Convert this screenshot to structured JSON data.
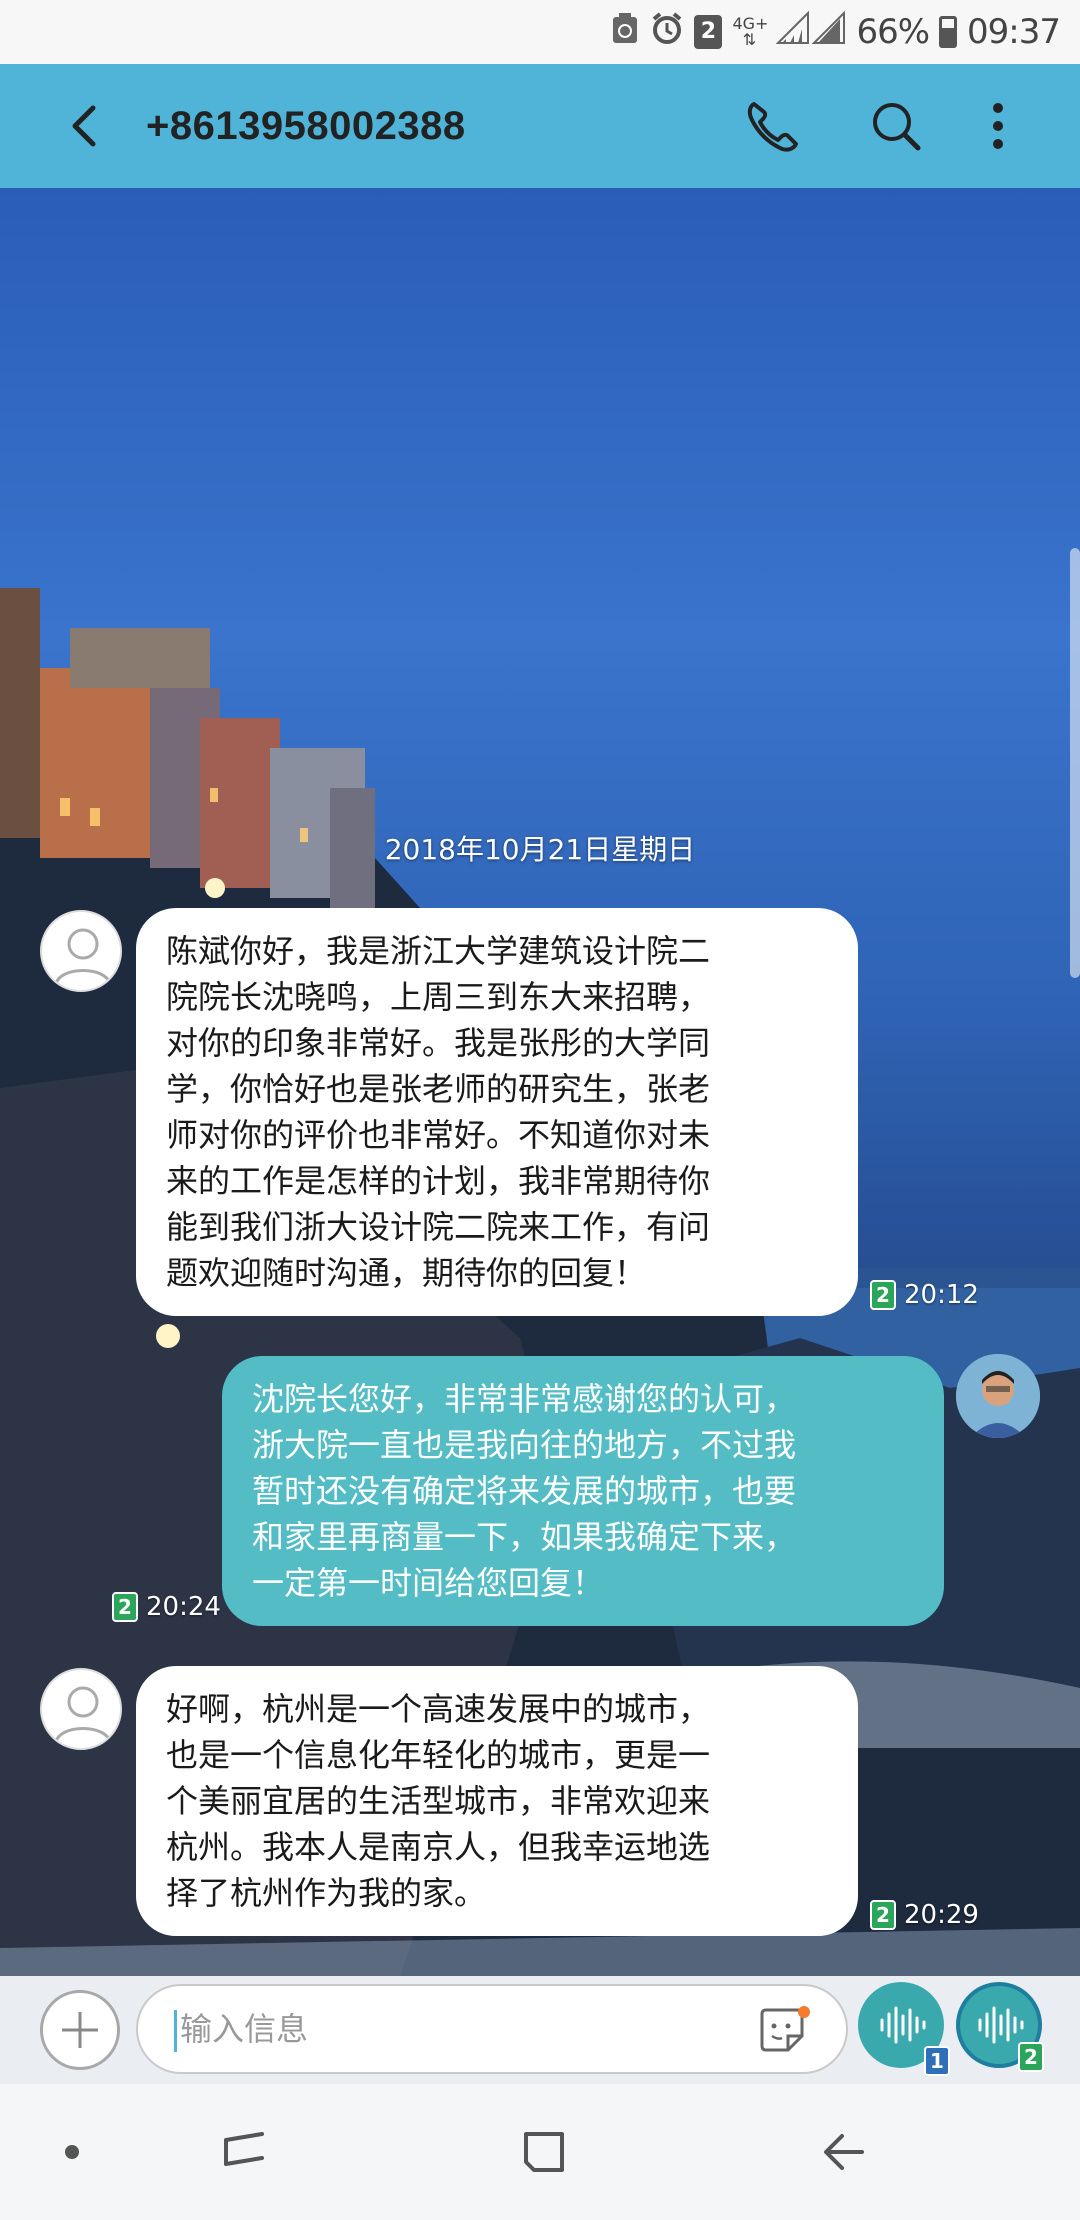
{
  "status_bar": {
    "sim_slot": "2",
    "network": "4G+",
    "battery": "66%",
    "time": "09:37"
  },
  "header": {
    "title": "+8613958002388"
  },
  "conversation": {
    "date": "2018年10月21日星期日",
    "messages": [
      {
        "direction": "incoming",
        "sim": "2",
        "time": "20:12",
        "lines": [
          "陈斌你好，我是浙江大学建筑设计院二",
          "院院长沈晓鸣，上周三到东大来招聘，",
          "对你的印象非常好。我是张彤的大学同",
          "学，你恰好也是张老师的研究生，张老",
          "师对你的评价也非常好。不知道你对未",
          "来的工作是怎样的计划，我非常期待你",
          "能到我们浙大设计院二院来工作，有问",
          "题欢迎随时沟通，期待你的回复！"
        ]
      },
      {
        "direction": "outgoing",
        "sim": "2",
        "time": "20:24",
        "lines": [
          "沈院长您好，非常非常感谢您的认可，",
          "浙大院一直也是我向往的地方，不过我",
          "暂时还没有确定将来发展的城市，也要",
          "和家里再商量一下，如果我确定下来，",
          "一定第一时间给您回复！"
        ]
      },
      {
        "direction": "incoming",
        "sim": "2",
        "time": "20:29",
        "lines": [
          "好啊，杭州是一个高速发展中的城市，",
          "也是一个信息化年轻化的城市，更是一",
          "个美丽宜居的生活型城市，非常欢迎来",
          "杭州。我本人是南京人，但我幸运地选",
          "择了杭州作为我的家。"
        ]
      }
    ]
  },
  "composer": {
    "placeholder": "输入信息",
    "send_sim1_badge": "1",
    "send_sim2_badge": "2"
  },
  "colors": {
    "app_bar": "#4fb4d8",
    "outgoing_bubble": "#53bcc4",
    "incoming_bubble": "#ffffff",
    "sim_badge": "#2aa55a"
  },
  "icons": {
    "back": "back-arrow-icon",
    "call": "phone-icon",
    "search": "search-icon",
    "more": "more-vertical-icon",
    "add": "plus-icon",
    "sticker": "sticker-icon",
    "send": "voice-wave-icon"
  }
}
